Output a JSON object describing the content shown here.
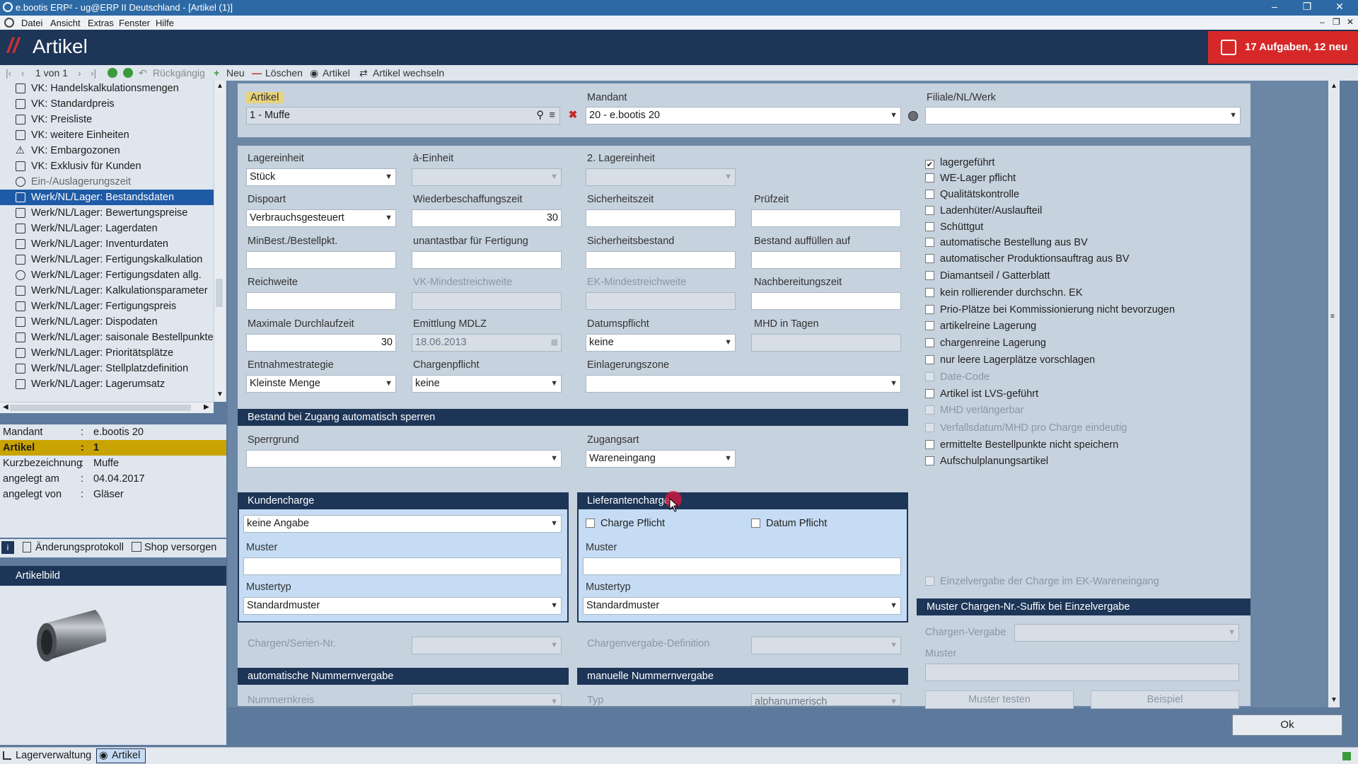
{
  "window": {
    "title": "e.bootis ERP² - ug@ERP II Deutschland - [Artikel (1)]",
    "menu": [
      "Datei",
      "Ansicht",
      "Extras",
      "Fenster",
      "Hilfe"
    ]
  },
  "header": {
    "title": "Artikel",
    "tasks": "17 Aufgaben, 12 neu"
  },
  "toolbar": {
    "record": "1 von 1",
    "undo": "Rückgängig",
    "new": "Neu",
    "delete": "Löschen",
    "artikel": "Artikel",
    "switch": "Artikel wechseln"
  },
  "tree": {
    "items": [
      "VK: Handelskalkulationsmengen",
      "VK: Standardpreis",
      "VK: Preisliste",
      "VK: weitere Einheiten",
      "VK: Embargozonen",
      "VK: Exklusiv für Kunden",
      "Ein-/Auslagerungszeit",
      "Werk/NL/Lager: Bestandsdaten",
      "Werk/NL/Lager: Bewertungspreise",
      "Werk/NL/Lager: Lagerdaten",
      "Werk/NL/Lager: Inventurdaten",
      "Werk/NL/Lager: Fertigungskalkulation",
      "Werk/NL/Lager: Fertigungsdaten allg.",
      "Werk/NL/Lager: Kalkulationsparameter",
      "Werk/NL/Lager: Fertigungspreis",
      "Werk/NL/Lager: Dispodaten",
      "Werk/NL/Lager: saisonale Bestellpunkte",
      "Werk/NL/Lager: Prioritätsplätze",
      "Werk/NL/Lager: Stellplatzdefinition",
      "Werk/NL/Lager: Lagerumsatz"
    ]
  },
  "info": {
    "rows": [
      {
        "k": "Mandant",
        "v": "e.bootis 20"
      },
      {
        "k": "Artikel",
        "v": "1"
      },
      {
        "k": "Kurzbezeichnung",
        "v": "Muffe"
      },
      {
        "k": "angelegt am",
        "v": "04.04.2017"
      },
      {
        "k": "angelegt von",
        "v": "Gläser"
      }
    ],
    "changelog": "Änderungsprotokoll",
    "shop": "Shop versorgen",
    "image_header": "Artikelbild"
  },
  "top": {
    "artikel_label": "Artikel",
    "artikel_value": "1 - Muffe",
    "mandant_label": "Mandant",
    "mandant_value": "20 - e.bootis 20",
    "filiale_label": "Filiale/NL/Werk",
    "filiale_value": ""
  },
  "form": {
    "lagereinheit_l": "Lagereinheit",
    "lagereinheit_v": "Stück",
    "aeinheit_l": "à-Einheit",
    "lagereinheit2_l": "2. Lagereinheit",
    "dispoart_l": "Dispoart",
    "dispoart_v": "Verbrauchsgesteuert",
    "wbz_l": "Wiederbeschaffungszeit",
    "wbz_v": "30",
    "sicherheitszeit_l": "Sicherheitszeit",
    "pruefzeit_l": "Prüfzeit",
    "minbest_l": "MinBest./Bestellpkt.",
    "unantastbar_l": "unantastbar für Fertigung",
    "sicherheitsbestand_l": "Sicherheitsbestand",
    "auffuellen_l": "Bestand auffüllen auf",
    "reichweite_l": "Reichweite",
    "vkmin_l": "VK-Mindestreichweite",
    "ekmin_l": "EK-Mindestreichweite",
    "nachbereitung_l": "Nachbereitungszeit",
    "maxdlz_l": "Maximale Durchlaufzeit",
    "maxdlz_v": "30",
    "mdlz_l": "Emittlung MDLZ",
    "mdlz_v": "18.06.2013",
    "datumspflicht_l": "Datumspflicht",
    "datumspflicht_v": "keine",
    "mhd_l": "MHD in Tagen",
    "entnahme_l": "Entnahmestrategie",
    "entnahme_v": "Kleinste Menge",
    "chargenpflicht_l": "Chargenpflicht",
    "chargenpflicht_v": "keine",
    "einlagerungszone_l": "Einlagerungszone",
    "sperren_head": "Bestand bei Zugang automatisch sperren",
    "sperrgrund_l": "Sperrgrund",
    "zugangsart_l": "Zugangsart",
    "zugangsart_v": "Wareneingang",
    "kundencharge_head": "Kundencharge",
    "kundencharge_v": "keine Angabe",
    "muster_l": "Muster",
    "mustertyp_l": "Mustertyp",
    "mustertyp_v": "Standardmuster",
    "lieferantencharge_head": "Lieferantencharge",
    "charge_pflicht": "Charge Pflicht",
    "datum_pflicht": "Datum Pflicht",
    "chargen_serien_l": "Chargen/Serien-Nr.",
    "chargenvergabe_def_l": "Chargenvergabe-Definition",
    "auto_nr_head": "automatische Nummernvergabe",
    "nummernkreis_l": "Nummernkreis",
    "manual_nr_head": "manuelle Nummernvergabe",
    "typ_l": "Typ",
    "typ_v": "alphanumerisch"
  },
  "checks": [
    {
      "label": "lagergeführt",
      "checked": true,
      "enabled": true
    },
    {
      "label": "WE-Lager pflicht",
      "checked": false,
      "enabled": true
    },
    {
      "label": "Qualitätskontrolle",
      "checked": false,
      "enabled": true
    },
    {
      "label": "Ladenhüter/Auslaufteil",
      "checked": false,
      "enabled": true
    },
    {
      "label": "Schüttgut",
      "checked": false,
      "enabled": true
    },
    {
      "label": "automatische Bestellung aus BV",
      "checked": false,
      "enabled": true
    },
    {
      "label": "automatischer Produktionsauftrag aus BV",
      "checked": false,
      "enabled": true
    },
    {
      "label": "Diamantseil / Gatterblatt",
      "checked": false,
      "enabled": true
    },
    {
      "label": "kein rollierender durchschn. EK",
      "checked": false,
      "enabled": true
    },
    {
      "label": "Prio-Plätze bei Kommissionierung nicht bevorzugen",
      "checked": false,
      "enabled": true
    },
    {
      "label": "artikelreine Lagerung",
      "checked": false,
      "enabled": true
    },
    {
      "label": "chargenreine Lagerung",
      "checked": false,
      "enabled": true
    },
    {
      "label": "nur leere Lagerplätze vorschlagen",
      "checked": false,
      "enabled": true
    },
    {
      "label": "Date-Code",
      "checked": false,
      "enabled": false
    },
    {
      "label": "Artikel ist LVS-geführt",
      "checked": false,
      "enabled": true
    },
    {
      "label": "MHD verlängerbar",
      "checked": false,
      "enabled": false
    },
    {
      "label": "Verfallsdatum/MHD pro Charge eindeutig",
      "checked": false,
      "enabled": false
    },
    {
      "label": "ermittelte Bestellpunkte nicht speichern",
      "checked": false,
      "enabled": true
    },
    {
      "label": "Aufschulplanungsartikel",
      "checked": false,
      "enabled": true
    }
  ],
  "right_lower": {
    "einzelvergabe": "Einzelvergabe der Charge im EK-Wareneingang",
    "muster_head": "Muster Chargen-Nr.-Suffix bei Einzelvergabe",
    "chargen_vergabe_l": "Chargen-Vergabe",
    "muster_l": "Muster",
    "muster_testen": "Muster testen",
    "beispiel": "Beispiel"
  },
  "ok": "Ok",
  "statusbar": {
    "lagerverwaltung": "Lagerverwaltung",
    "artikel": "Artikel"
  }
}
